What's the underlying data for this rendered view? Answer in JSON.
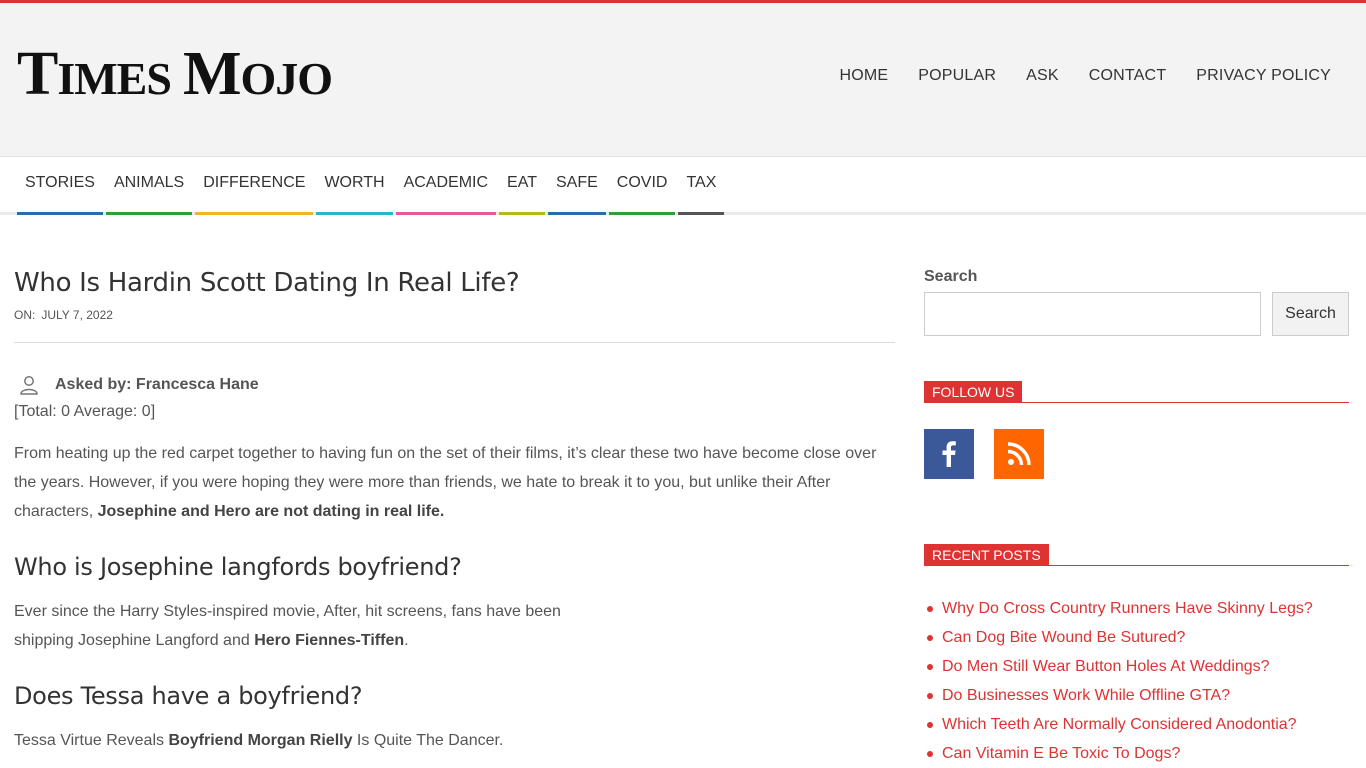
{
  "site": {
    "logo_first_cap": "T",
    "logo_first_rest": "IMES",
    "logo_second_cap": "M",
    "logo_second_rest": "OJO"
  },
  "top_nav": [
    "HOME",
    "POPULAR",
    "ASK",
    "CONTACT",
    "PRIVACY POLICY"
  ],
  "categories": [
    {
      "label": "STORIES",
      "color": "#2b6cb0"
    },
    {
      "label": "ANIMALS",
      "color": "#2e9e3f"
    },
    {
      "label": "DIFFERENCE",
      "color": "#f0b429"
    },
    {
      "label": "WORTH",
      "color": "#29b6c8"
    },
    {
      "label": "ACADEMIC",
      "color": "#e8579c"
    },
    {
      "label": "EAT",
      "color": "#b5b81a"
    },
    {
      "label": "SAFE",
      "color": "#2b6cb0"
    },
    {
      "label": "COVID",
      "color": "#2e9e3f"
    },
    {
      "label": "TAX",
      "color": "#555555"
    }
  ],
  "post": {
    "title": "Who Is Hardin Scott Dating In Real Life?",
    "meta_label": "ON:",
    "date": "JULY 7, 2022",
    "asked_by": "Asked by: Francesca Hane",
    "rating": "[Total: 0 Average: 0]",
    "para1_text": "From heating up the red carpet together to having fun on the set of their films, it’s clear these two have become close over the years. However, if you were hoping they were more than friends, we hate to break it to you, but unlike their After characters, ",
    "para1_bold": "Josephine and Hero are not dating in real life.",
    "h2_1": "Who is Josephine langfords boyfriend?",
    "para2_text": "Ever since the Harry Styles-inspired movie, After, hit screens, fans have been shipping Josephine Langford and ",
    "para2_bold": "Hero Fiennes-Tiffen",
    "para2_end": ".",
    "h2_2": "Does Tessa have a boyfriend?",
    "para3_start": "Tessa Virtue Reveals ",
    "para3_bold": "Boyfriend Morgan Rielly",
    "para3_end": " Is Quite The Dancer."
  },
  "sidebar": {
    "search_label": "Search",
    "search_value": "",
    "search_button": "Search",
    "follow_title": "FOLLOW US",
    "recent_title": "RECENT POSTS",
    "recent_posts": [
      "Why Do Cross Country Runners Have Skinny Legs?",
      "Can Dog Bite Wound Be Sutured?",
      "Do Men Still Wear Button Holes At Weddings?",
      "Do Businesses Work While Offline GTA?",
      "Which Teeth Are Normally Considered Anodontia?",
      "Can Vitamin E Be Toxic To Dogs?"
    ]
  },
  "colors": {
    "accent": "#dd3333",
    "facebook": "#3b5998",
    "rss": "#ff6600"
  }
}
